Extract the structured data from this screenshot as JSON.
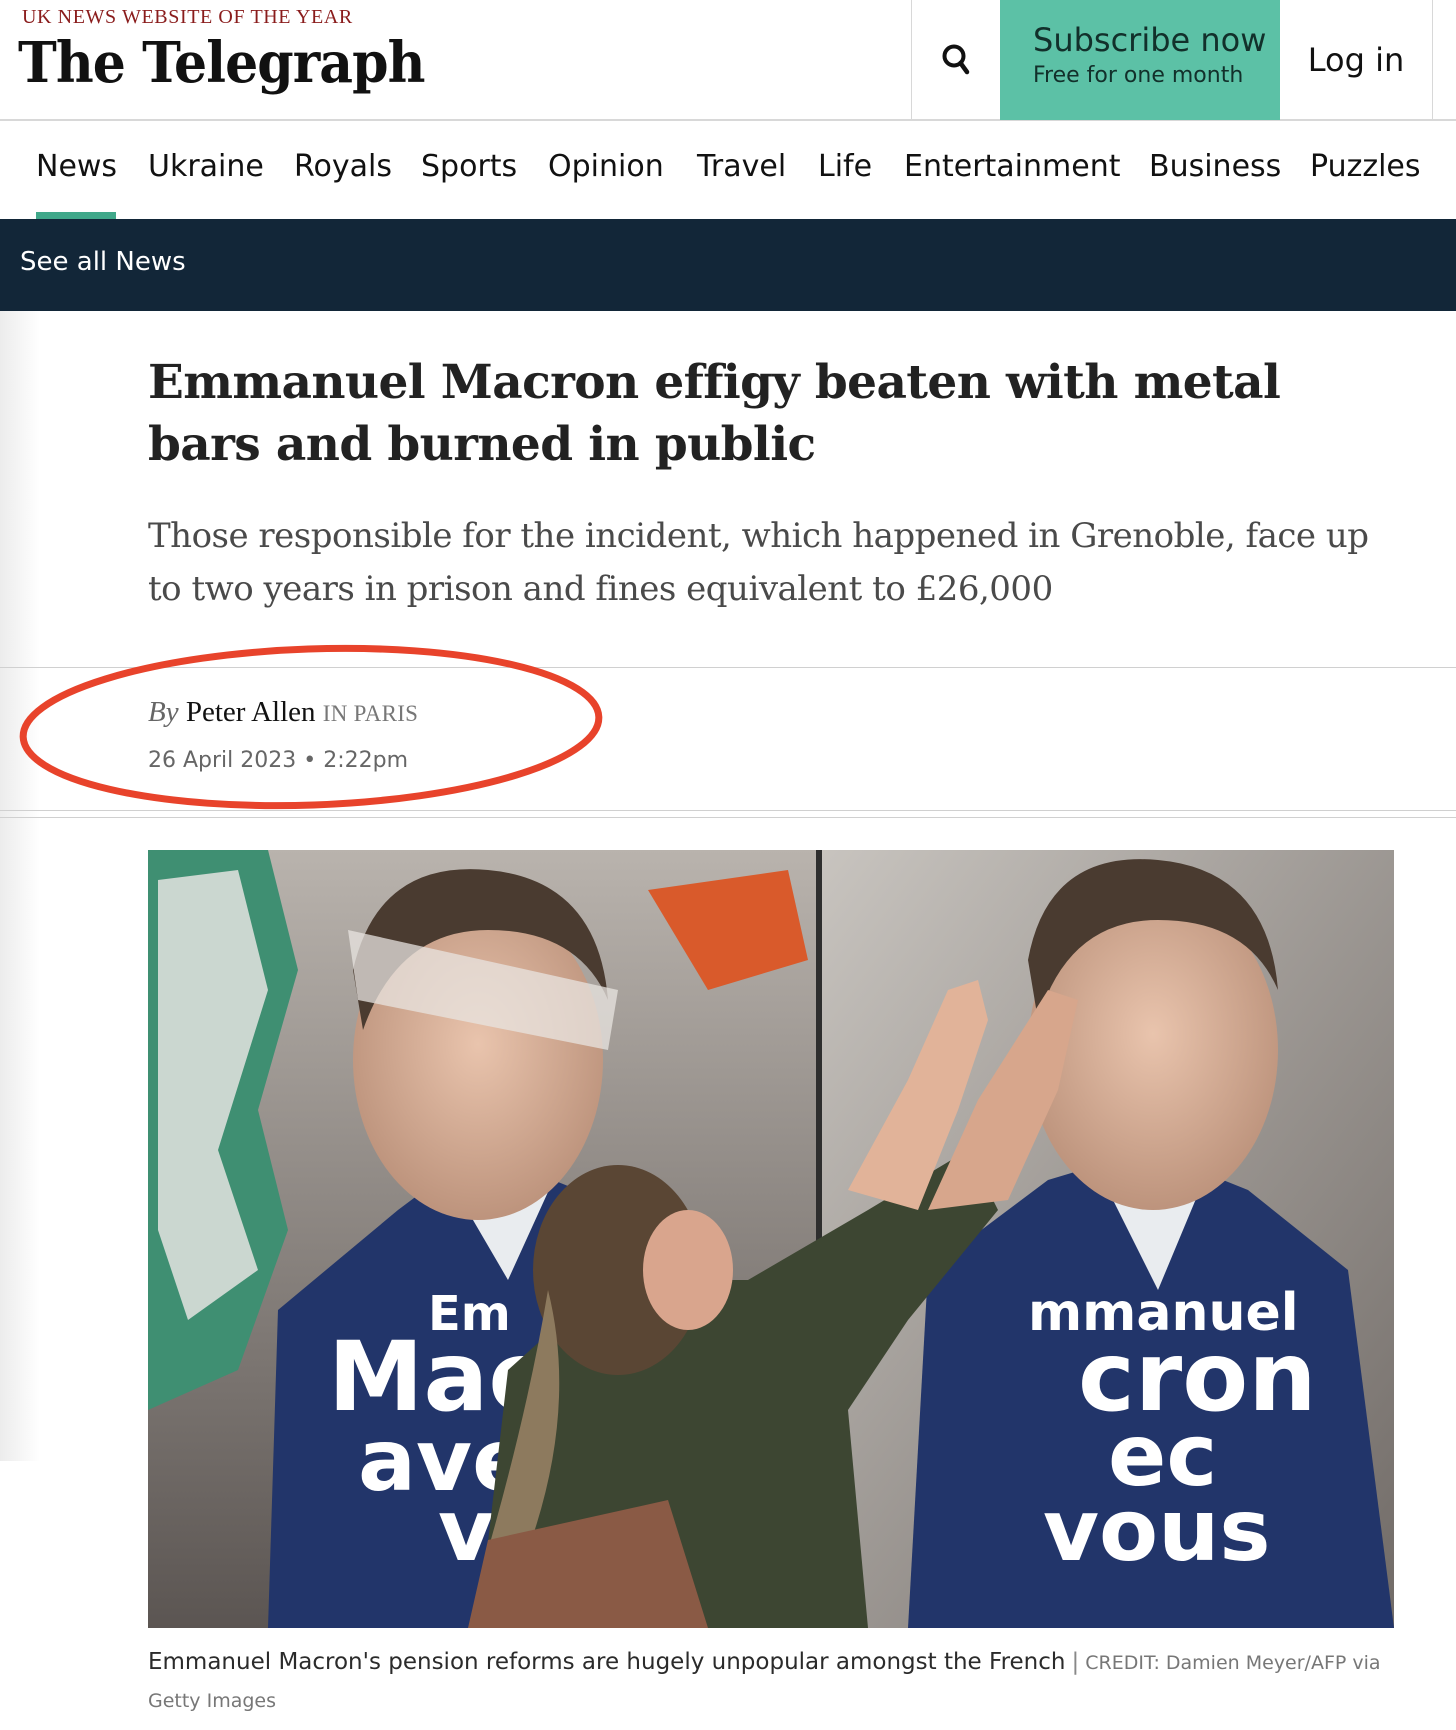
{
  "header": {
    "tagline": "UK NEWS WEBSITE OF THE YEAR",
    "masthead": "The Telegraph",
    "search_icon": "search-icon",
    "subscribe_main": "Subscribe now",
    "subscribe_sub": "Free for one month",
    "login_label": "Log in",
    "accent_color": "#5cc1a6"
  },
  "nav": {
    "items": [
      {
        "label": "News",
        "active": true
      },
      {
        "label": "Ukraine"
      },
      {
        "label": "Royals"
      },
      {
        "label": "Sports"
      },
      {
        "label": "Opinion"
      },
      {
        "label": "Travel"
      },
      {
        "label": "Life"
      },
      {
        "label": "Entertainment"
      },
      {
        "label": "Business"
      },
      {
        "label": "Puzzles"
      }
    ],
    "subnav_link": "See all News",
    "subnav_color": "#122638"
  },
  "article": {
    "headline": "Emmanuel Macron effigy beaten with metal bars and burned in public",
    "standfirst": "Those responsible for the incident, which happened in Grenoble, face up to two years in prison and fines equivalent to £26,000",
    "byline_by": "By",
    "byline_author": "Peter Allen",
    "byline_location": "IN PARIS",
    "date": "26 April 2023 • 2:22pm",
    "annotation_color": "#e8432b"
  },
  "photo": {
    "poster_left_lines": [
      "Em",
      "Mac",
      "ave",
      "v"
    ],
    "poster_right_lines": [
      "mmanuel",
      "cron",
      "ec",
      "vous"
    ],
    "caption": "Emmanuel Macron's pension reforms are hugely unpopular amongst the French",
    "credit": "CREDIT: Damien Meyer/AFP via Getty Images"
  }
}
